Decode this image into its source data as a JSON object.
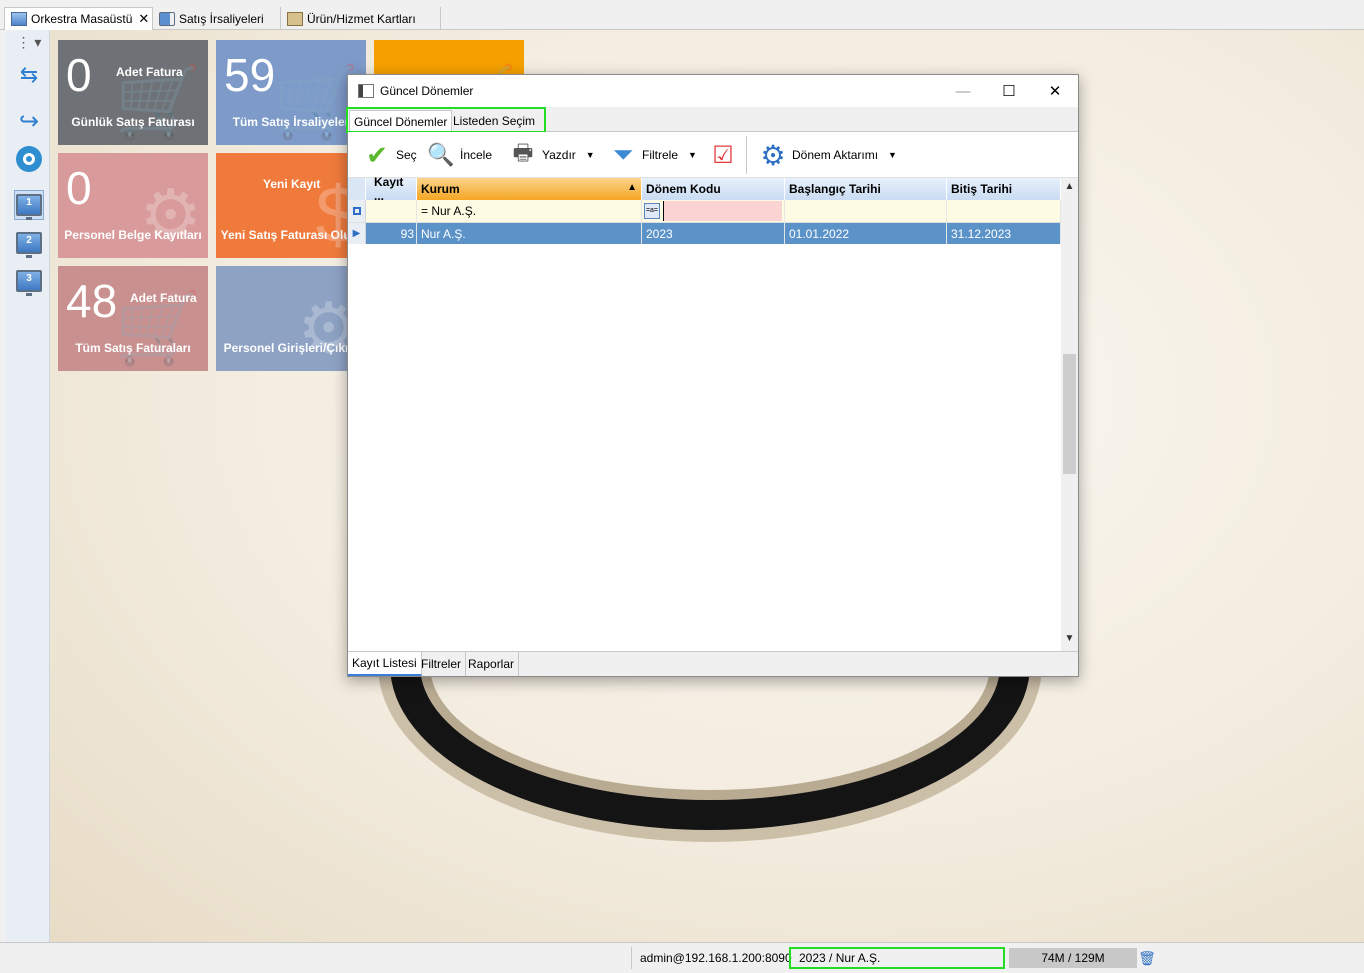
{
  "app_tabs": [
    {
      "label": "Orkestra Masaüstü",
      "icon": "desktop-icon",
      "active": true
    },
    {
      "label": "Satış İrsaliyeleri",
      "icon": "truck-icon",
      "active": false
    },
    {
      "label": "Ürün/Hizmet Kartları",
      "icon": "box-icon",
      "active": false
    }
  ],
  "left_toolbar": {
    "desktops": [
      "1",
      "2",
      "3"
    ]
  },
  "tiles": [
    {
      "num": "0",
      "top": "Adet Fatura",
      "label": "Günlük Satış Faturası",
      "color": "#6e7175"
    },
    {
      "num": "59",
      "top": "",
      "label": "Tüm Satış İrsaliyeler",
      "color": "#7d9ac8"
    },
    {
      "num": "",
      "top": "",
      "label": "",
      "color": "#f5a000"
    },
    {
      "num": "0",
      "top": "",
      "label": "Personel Belge Kayıtları",
      "color": "#d89a9a"
    },
    {
      "num": "",
      "top": "Yeni Kayıt",
      "label": "Yeni Satış Faturası Oluşt",
      "color": "#f07a3c"
    },
    {
      "num": "48",
      "top": "Adet Fatura",
      "label": "Tüm Satış Faturaları",
      "color": "#c99090"
    },
    {
      "num": "",
      "top": "",
      "label": "Personel Girişleri/Çıkışl",
      "color": "#8ea2c4"
    }
  ],
  "dialog": {
    "title": "Güncel Dönemler",
    "tabs": [
      "Güncel Dönemler",
      "Listeden Seçim"
    ],
    "toolbar": {
      "sec": "Seç",
      "incele": "İncele",
      "yazdir": "Yazdır",
      "filtrele": "Filtrele",
      "donem_aktarimi": "Dönem Aktarımı"
    },
    "grid": {
      "columns": [
        "Kayıt ...",
        "Kurum",
        "Dönem Kodu",
        "Başlangıç Tarihi",
        "Bitiş Tarihi"
      ],
      "filter_row": {
        "kurum": "= Nur A.Ş.",
        "donem_badge": "=a="
      },
      "rows": [
        {
          "kayit": "93",
          "kurum": "Nur A.Ş.",
          "donem_kodu": "2023",
          "baslangic": "01.01.2022",
          "bitis": "31.12.2023"
        }
      ]
    },
    "bottom_tabs": [
      "Kayıt Listesi",
      "Filtreler",
      "Raporlar"
    ]
  },
  "status_bar": {
    "connection": "admin@192.168.1.200:8090",
    "period": "2023 / Nur A.Ş.",
    "memory": "74M / 129M"
  }
}
